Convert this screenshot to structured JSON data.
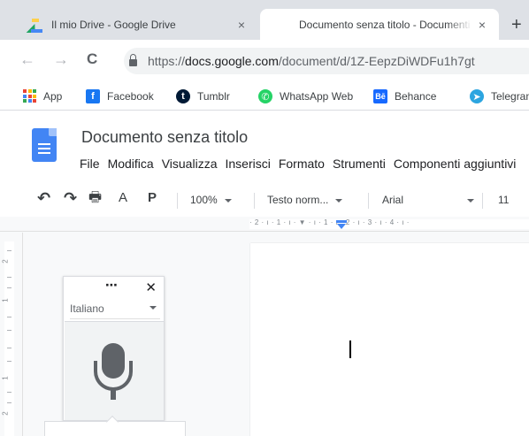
{
  "browser": {
    "tabs": [
      {
        "title": "Il mio Drive - Google Drive",
        "active": false,
        "icon": "google-drive-icon"
      },
      {
        "title": "Documento senza titolo - Documenti Google",
        "active": true,
        "icon": "google-docs-icon"
      }
    ],
    "close_glyph": "×",
    "new_tab_glyph": "+",
    "nav": {
      "back": "←",
      "forward": "→",
      "reload": "C"
    },
    "url": {
      "scheme": "https://",
      "host": "docs.google.com",
      "path": "/document/d/1Z-EepzDiWDFu1h7gt"
    },
    "bookmarks": [
      {
        "label": "App",
        "icon": "apps-grid-icon"
      },
      {
        "label": "Facebook",
        "icon": "facebook-icon"
      },
      {
        "label": "Tumblr",
        "icon": "tumblr-icon"
      },
      {
        "label": "WhatsApp Web",
        "icon": "whatsapp-icon"
      },
      {
        "label": "Behance",
        "icon": "behance-icon"
      },
      {
        "label": "Telegram",
        "icon": "telegram-icon"
      }
    ]
  },
  "docs": {
    "title": "Documento senza titolo",
    "menu": [
      "File",
      "Modifica",
      "Visualizza",
      "Inserisci",
      "Formato",
      "Strumenti",
      "Componenti aggiuntivi"
    ],
    "toolbar": {
      "undo": "↶",
      "redo": "↷",
      "print": "🖶",
      "spellcheck": "A",
      "paint_format": "P",
      "zoom": "100%",
      "style": "Testo norm...",
      "font": "Arial",
      "font_size": "11"
    },
    "ruler": {
      "text": "· 2 · ı · 1 · ı · ▼ · ı · 1 · ı · 2 · ı · 3 · ı · 4 · ı ·",
      "vertical_labels": [
        "2",
        "1",
        "1",
        "2"
      ]
    }
  },
  "voice_typing": {
    "more_label": "⋯",
    "close_label": "✕",
    "language": "Italiano"
  },
  "colors": {
    "tabstrip": "#dee1e6",
    "docs_blue": "#4285f4",
    "canvas": "#f8f9fa",
    "facebook": "#1877f2",
    "tumblr": "#001935",
    "whatsapp": "#25d366",
    "behance": "#1769ff",
    "telegram": "#2ca5e0"
  }
}
